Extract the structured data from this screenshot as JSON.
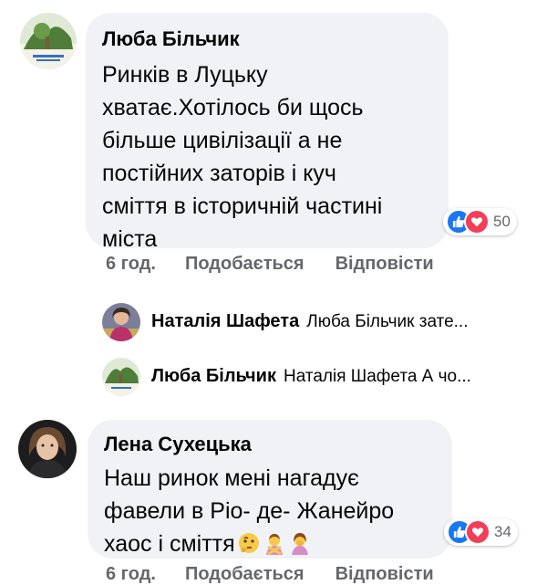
{
  "comments": [
    {
      "author": "Люба Більчик",
      "text": "Ринків в Луцьку\nхватає.Хотілось би щось\nбільше цивілізації а не\nпостійних заторів і куч\nсміття в історичній частині\nміста",
      "reaction_count": "50",
      "time": "6 год.",
      "like_label": "Подобається",
      "reply_label": "Відповісти"
    },
    {
      "author": "Лена Сухецька",
      "text": "Наш ринок мені нагадує\nфавели в Ріо- де- Жанейро\nхаос і сміття",
      "reaction_count": "34",
      "time": "6 год.",
      "like_label": "Подобається",
      "reply_label": "Відповісти"
    }
  ],
  "replies": [
    {
      "author": "Наталія Шафета",
      "preview": "Люба Більчик зате..."
    },
    {
      "author": "Люба Більчик",
      "preview": "Наталія Шафета А чо..."
    }
  ],
  "icons": {
    "like": "thumbs-up-icon",
    "love": "heart-icon",
    "emojis": [
      "thinking-face-icon",
      "person-gesturing-no-icon",
      "person-facepalming-icon"
    ]
  },
  "colors": {
    "like": "#1877f2",
    "love": "#f33e58",
    "bubble": "#f0f2f5",
    "meta": "#65676b"
  }
}
